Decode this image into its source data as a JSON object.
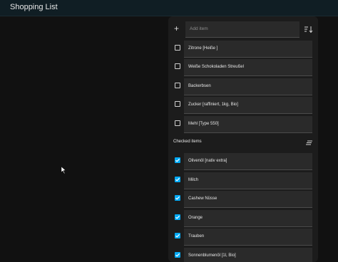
{
  "header": {
    "title": "Shopping List"
  },
  "add_item": {
    "placeholder": "Add item"
  },
  "unchecked_items": [
    {
      "label": "Zitrone [Heiße ]"
    },
    {
      "label": "Weiße Schokoladen Streußel"
    },
    {
      "label": "Backerbsen"
    },
    {
      "label": "Zucker [raffiniert, 1kg, Bio]"
    },
    {
      "label": "Mehl [Type 550]"
    }
  ],
  "checked_section": {
    "title": "Checked items"
  },
  "checked_items": [
    {
      "label": "Olivenöl [nativ extra]"
    },
    {
      "label": "Milch"
    },
    {
      "label": "Cashew Nüsse"
    },
    {
      "label": "Orange"
    },
    {
      "label": "Trauben"
    },
    {
      "label": "Sonnenblumenöl [1l, Bio]"
    }
  ],
  "colors": {
    "accent": "#03a9f4",
    "topbar": "#101e24",
    "card": "#1c1c1c",
    "field": "#2a2a2a"
  },
  "icons": {
    "add": "plus-icon",
    "sort": "sort-icon",
    "clear": "clear-checked-icon"
  }
}
